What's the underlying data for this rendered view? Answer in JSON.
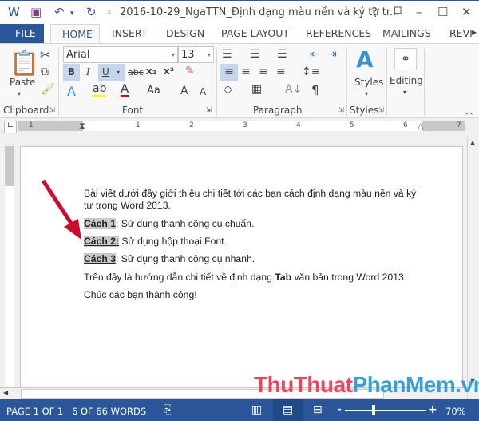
{
  "titlebar": {
    "title": "2016-10-29_NgaTTN_Định dạng màu nền và ký tự tr...",
    "help": "?",
    "icons": [
      "word-icon",
      "save-icon",
      "undo-icon",
      "redo-icon",
      "customize-icon"
    ]
  },
  "tabs": {
    "file": "FILE",
    "home": "HOME",
    "others": [
      "INSERT",
      "DESIGN",
      "PAGE LAYOUT",
      "REFERENCES",
      "MAILINGS",
      "REVI"
    ]
  },
  "ribbon": {
    "clipboard": {
      "paste": "Paste",
      "label": "Clipboard"
    },
    "font": {
      "name": "Arial",
      "size": "13",
      "label": "Font",
      "bold": "B",
      "italic": "I",
      "underline": "U",
      "strike": "abc",
      "sub": "x₂",
      "sup": "x²",
      "case": "Aa",
      "grow": "A",
      "shrink": "A"
    },
    "paragraph": {
      "label": "Paragraph"
    },
    "styles": {
      "button": "Styles",
      "label": "Styles"
    },
    "editing": {
      "button": "Editing"
    }
  },
  "ruler": {
    "ticks": [
      "1",
      "1",
      "2",
      "3",
      "4",
      "5",
      "6",
      "7"
    ]
  },
  "document": {
    "lines": [
      {
        "text": "Bài viết dưới đây giới thiệu chi tiết tới các bạn cách định dạng màu nền và ký"
      },
      {
        "text": "tự trong Word 2013."
      },
      {
        "hl": "Cách 1",
        "rest": ": Sử dụng thanh công cụ chuẩn."
      },
      {
        "hl": "Cách 2:",
        "rest": " Sử dụng hộp thoại Font."
      },
      {
        "hl": "Cách 3",
        "rest": ": Sử dụng thanh công cụ nhanh."
      },
      {
        "pre": "Trên đây là hướng dẫn chi tiết về định dạng ",
        "bold": "Tab",
        "post": " văn bản trong Word 2013."
      },
      {
        "text": "Chúc các bạn thành công!"
      }
    ]
  },
  "status": {
    "page": "PAGE 1 OF 1",
    "words": "6 OF 66 WORDS",
    "zoom": "70%",
    "zoom_percent": 70,
    "minus": "-",
    "plus": "+"
  },
  "watermark": {
    "part1": "ThuThuat",
    "part2": "PhanMem.vn"
  },
  "colors": {
    "accent": "#2b579a",
    "highlight": "#c8c8c8",
    "arrow": "#c8102e",
    "wm_red": "#e8475f",
    "wm_blue": "#3aa0d8"
  }
}
